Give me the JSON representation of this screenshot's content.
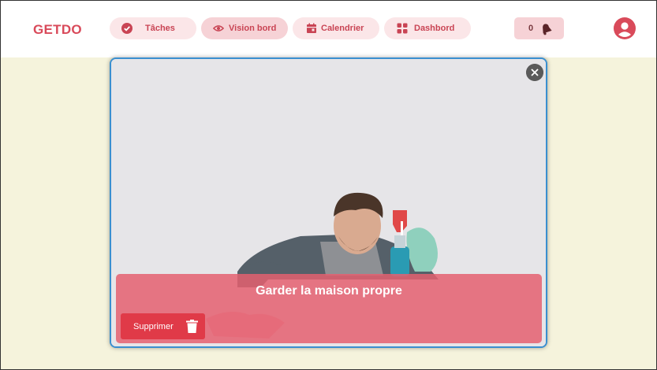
{
  "app": {
    "logo": "GETDO"
  },
  "nav": {
    "tasks": {
      "label": "Tâches",
      "icon": "check-circle-icon"
    },
    "vision": {
      "label": "Vision bord",
      "icon": "eye-icon"
    },
    "calendar": {
      "label": "Calendrier",
      "icon": "calendar-icon"
    },
    "dashboard": {
      "label": "Dashbord",
      "icon": "dashboard-icon"
    },
    "active": "vision"
  },
  "notifications": {
    "count": "0",
    "icon": "bell-icon"
  },
  "user": {
    "icon": "user-avatar-icon"
  },
  "modal": {
    "title": "Garder la maison propre",
    "delete_label": "Supprimer",
    "delete_icon": "trash-icon",
    "close_icon": "close-icon",
    "image": "man-cleaning-table-with-spray-bottle"
  },
  "colors": {
    "brand": "#d94a5a",
    "background": "#f5f3dc",
    "nav_pill": "#fbe6e8",
    "modal_border": "#3a8fd0",
    "caption_overlay": "#e46070",
    "delete_button": "#e03a48"
  }
}
